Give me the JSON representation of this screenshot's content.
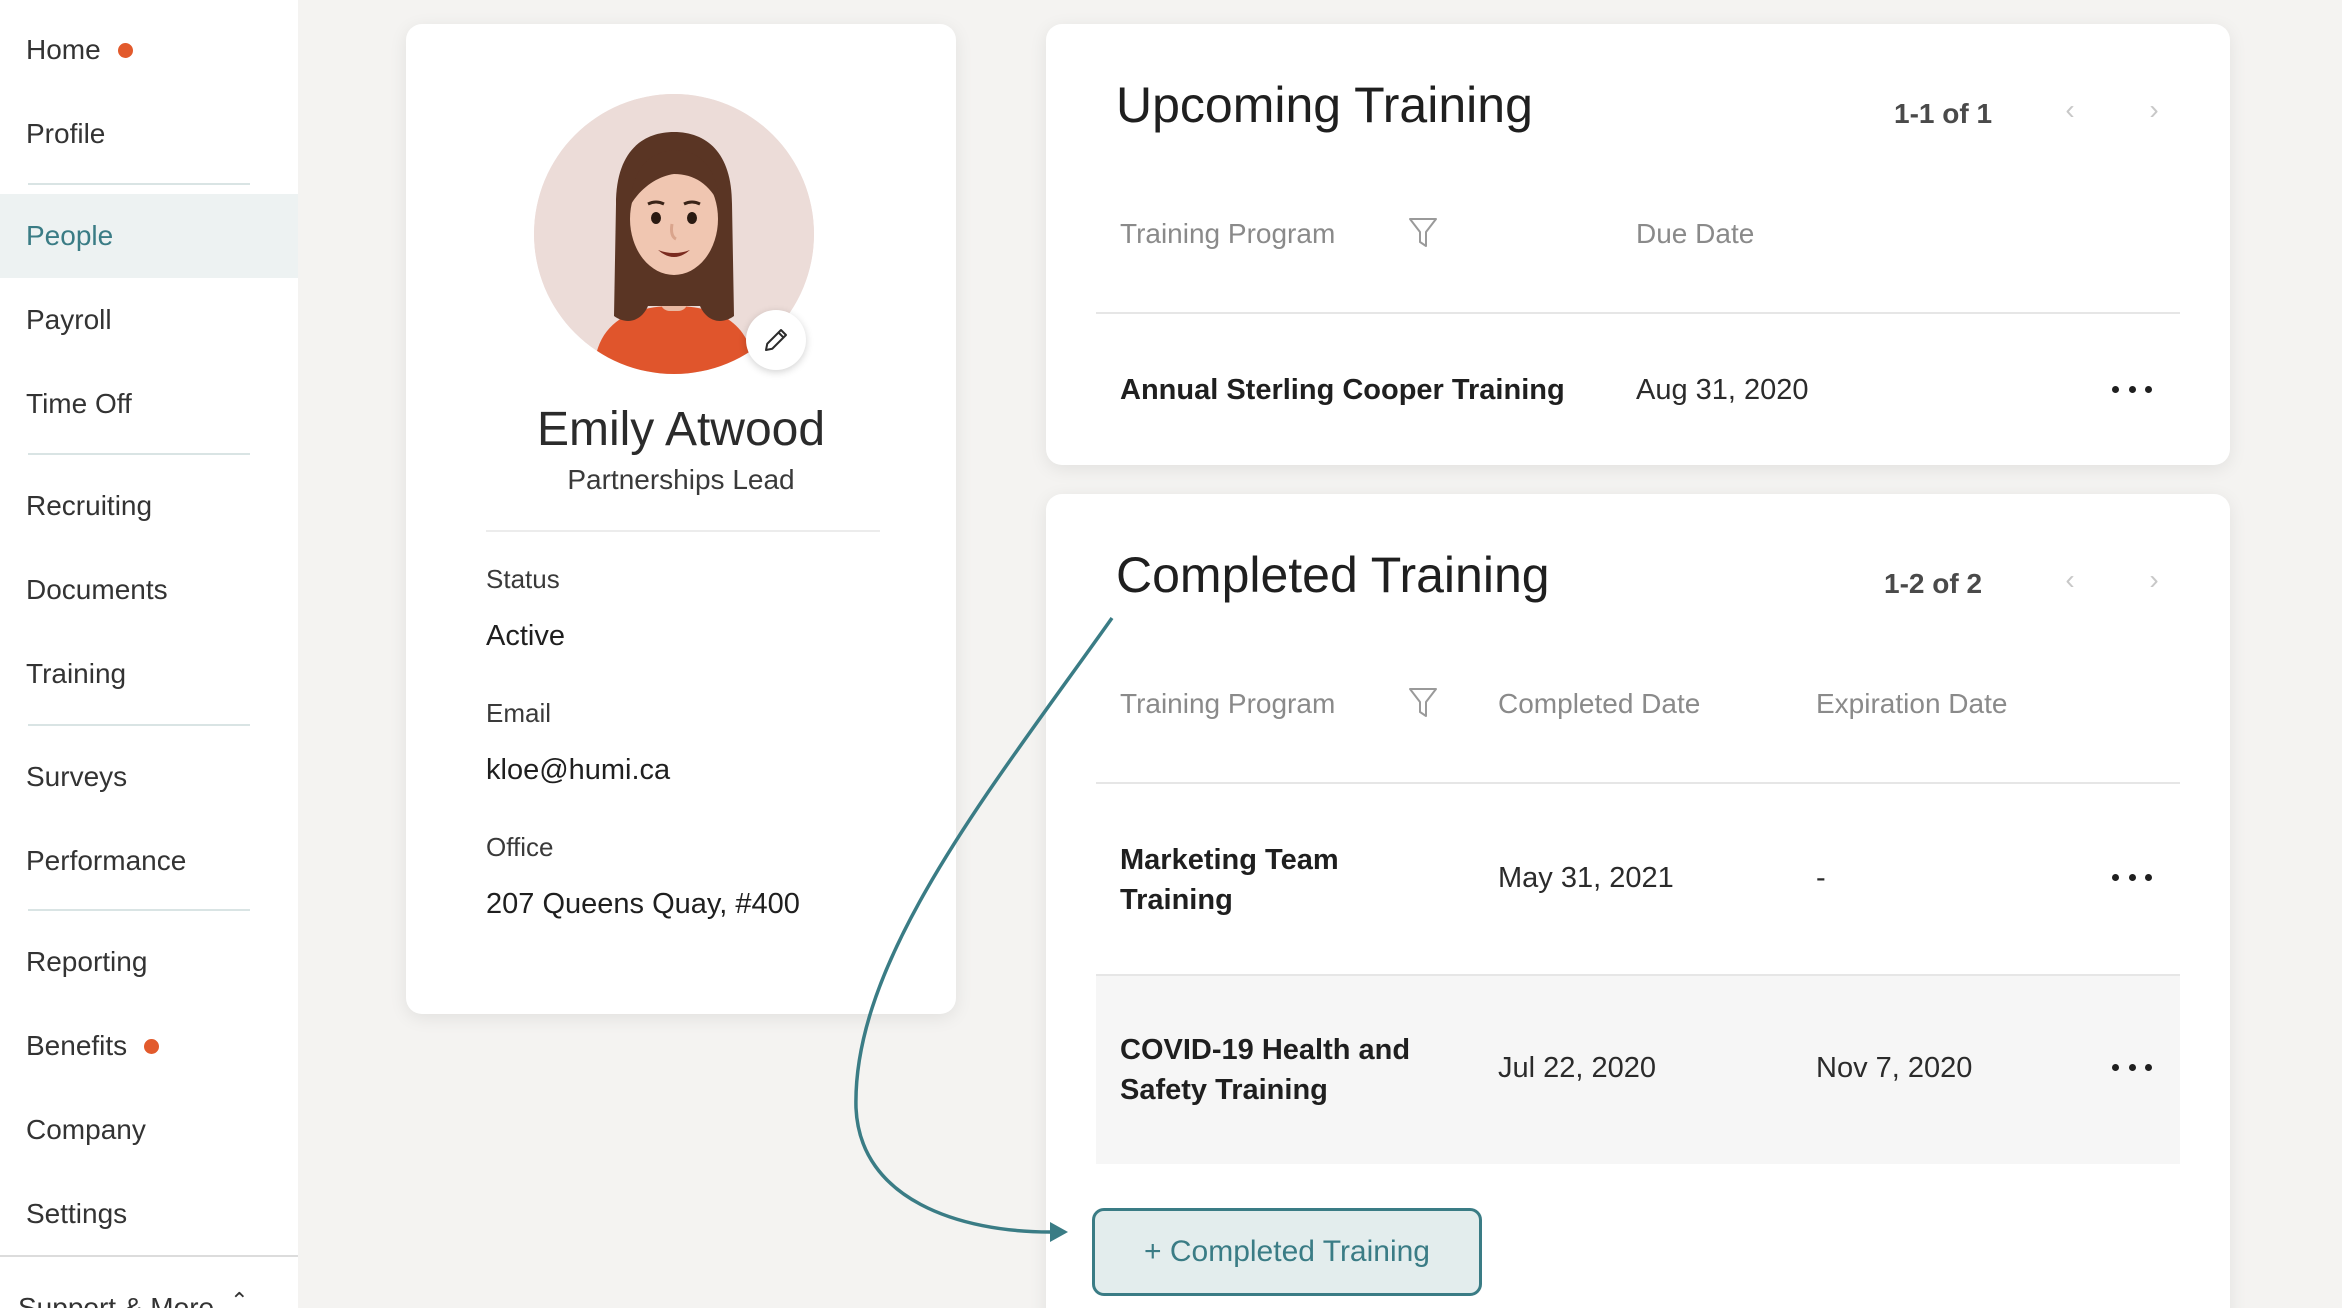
{
  "sidebar": {
    "items": [
      {
        "label": "Home",
        "dot": true
      },
      {
        "label": "Profile"
      },
      {
        "label": "People",
        "active": true
      },
      {
        "label": "Payroll"
      },
      {
        "label": "Time Off"
      },
      {
        "label": "Recruiting"
      },
      {
        "label": "Documents"
      },
      {
        "label": "Training"
      },
      {
        "label": "Surveys"
      },
      {
        "label": "Performance"
      },
      {
        "label": "Reporting"
      },
      {
        "label": "Benefits",
        "dot": true
      },
      {
        "label": "Company"
      },
      {
        "label": "Settings"
      }
    ],
    "support_label": "Support & More"
  },
  "profile": {
    "name": "Emily Atwood",
    "role": "Partnerships Lead",
    "status_label": "Status",
    "status_value": "Active",
    "email_label": "Email",
    "email_value": "kloe@humi.ca",
    "office_label": "Office",
    "office_value": "207 Queens Quay, #400"
  },
  "upcoming": {
    "title": "Upcoming Training",
    "pager": "1-1 of 1",
    "columns": [
      "Training Program",
      "Due Date"
    ],
    "rows": [
      {
        "program": "Annual Sterling Cooper Training",
        "due": "Aug 31, 2020"
      }
    ]
  },
  "completed": {
    "title": "Completed Training",
    "pager": "1-2 of 2",
    "columns": [
      "Training Program",
      "Completed Date",
      "Expiration Date"
    ],
    "rows": [
      {
        "program_line1": "Marketing Team",
        "program_line2": "Training",
        "completed": "May 31, 2021",
        "expiration": "-"
      },
      {
        "program_line1": "COVID-19 Health and",
        "program_line2": "Safety Training",
        "completed": "Jul 22, 2020",
        "expiration": "Nov 7, 2020"
      }
    ],
    "add_button": "+ Completed Training"
  },
  "colors": {
    "accent": "#3a7c85",
    "notification_dot": "#e25a2c"
  },
  "icons": {
    "pager_prev": "‹",
    "pager_next": "›"
  }
}
